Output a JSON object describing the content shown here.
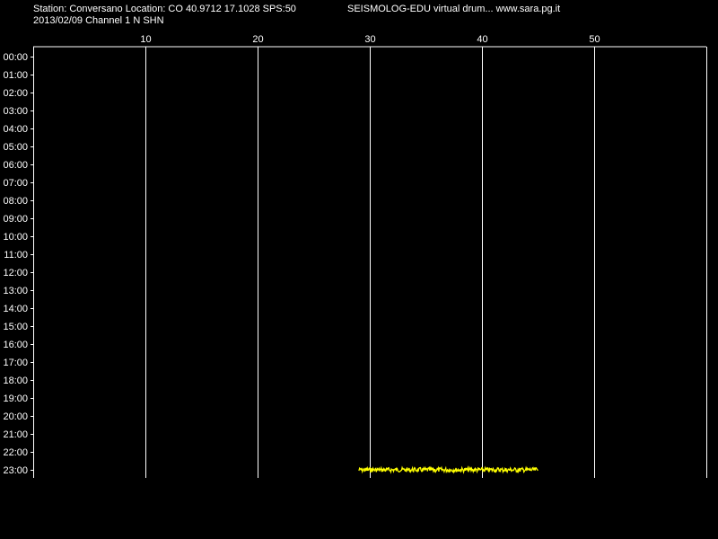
{
  "header": {
    "station_line": "Station: Conversano Location: CO 40.9712 17.1028 SPS:50",
    "date_line": "2013/02/09  Channel 1 N SHN",
    "title": "SEISMOLOG-EDU virtual drum... www.sara.pg.it"
  },
  "colors": {
    "background": "#000000",
    "grid": "#ffffff",
    "trace": "#ffff00"
  },
  "chart_data": {
    "type": "line",
    "x_axis": {
      "unit": "minutes",
      "range": [
        0,
        60
      ],
      "ticks": [
        10,
        20,
        30,
        40,
        50
      ]
    },
    "y_axis": {
      "labels": [
        "00:00",
        "01:00",
        "02:00",
        "03:00",
        "04:00",
        "05:00",
        "06:00",
        "07:00",
        "08:00",
        "09:00",
        "10:00",
        "11:00",
        "12:00",
        "13:00",
        "14:00",
        "15:00",
        "16:00",
        "17:00",
        "18:00",
        "19:00",
        "20:00",
        "21:00",
        "22:00",
        "23:00"
      ]
    },
    "grid": true,
    "series": [
      {
        "hour_row": "23:00",
        "x_start": 29,
        "x_end": 45,
        "color": "#ffff00"
      }
    ]
  }
}
